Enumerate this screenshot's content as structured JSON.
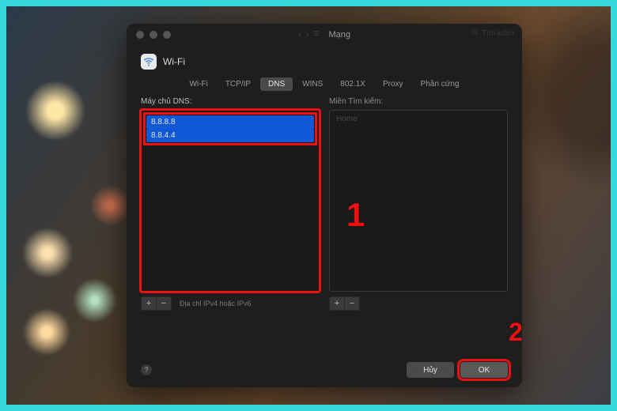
{
  "window": {
    "title": "Mạng",
    "search_placeholder": "Tìm kiếm"
  },
  "header": {
    "title": "Wi-Fi"
  },
  "tabs": [
    {
      "label": "Wi-Fi",
      "selected": false
    },
    {
      "label": "TCP/IP",
      "selected": false
    },
    {
      "label": "DNS",
      "selected": true
    },
    {
      "label": "WINS",
      "selected": false
    },
    {
      "label": "802.1X",
      "selected": false
    },
    {
      "label": "Proxy",
      "selected": false
    },
    {
      "label": "Phần cứng",
      "selected": false
    }
  ],
  "dns": {
    "label": "Máy chủ DNS:",
    "servers": [
      "8.8.8.8",
      "8.8.4.4"
    ],
    "hint": "Địa chỉ IPv4 hoặc IPv6"
  },
  "search_domains": {
    "label": "Miền Tìm kiếm:",
    "placeholder": "Home"
  },
  "buttons": {
    "add": "+",
    "remove": "−",
    "cancel": "Hủy",
    "ok": "OK",
    "help": "?"
  },
  "annotations": {
    "one": "1",
    "two": "2"
  }
}
